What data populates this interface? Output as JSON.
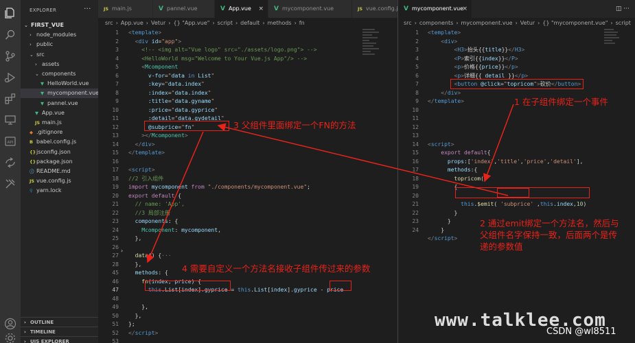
{
  "activity_bar": {
    "icons": [
      "files-icon",
      "search-icon",
      "source-control-icon",
      "run-debug-icon",
      "extensions-icon",
      "remote-explorer-icon",
      "api-icon",
      "live-share-icon",
      "tools-icon",
      "account-icon",
      "settings-gear-icon"
    ]
  },
  "sidebar": {
    "title": "EXPLORER",
    "more": "···",
    "tree": [
      {
        "label": "FIRST_VUE",
        "depth": 0,
        "type": "root",
        "twisty": "⌄"
      },
      {
        "label": "node_modules",
        "depth": 1,
        "type": "folder",
        "twisty": "›"
      },
      {
        "label": "public",
        "depth": 1,
        "type": "folder",
        "twisty": "›"
      },
      {
        "label": "src",
        "depth": 1,
        "type": "folder",
        "twisty": "⌄"
      },
      {
        "label": "assets",
        "depth": 2,
        "type": "folder",
        "twisty": "›"
      },
      {
        "label": "components",
        "depth": 2,
        "type": "folder",
        "twisty": "⌄"
      },
      {
        "label": "HelloWorld.vue",
        "depth": 3,
        "type": "vue"
      },
      {
        "label": "mycomponent.vue",
        "depth": 3,
        "type": "vue",
        "active": true
      },
      {
        "label": "pannel.vue",
        "depth": 3,
        "type": "vue"
      },
      {
        "label": "App.vue",
        "depth": 2,
        "type": "vue"
      },
      {
        "label": "main.js",
        "depth": 2,
        "type": "js"
      },
      {
        "label": ".gitignore",
        "depth": 1,
        "type": "git"
      },
      {
        "label": "babel.config.js",
        "depth": 1,
        "type": "babel"
      },
      {
        "label": "jsconfig.json",
        "depth": 1,
        "type": "json"
      },
      {
        "label": "package.json",
        "depth": 1,
        "type": "json"
      },
      {
        "label": "README.md",
        "depth": 1,
        "type": "md"
      },
      {
        "label": "vue.config.js",
        "depth": 1,
        "type": "js"
      },
      {
        "label": "yarn.lock",
        "depth": 1,
        "type": "yarn"
      }
    ],
    "sections": [
      {
        "label": "OUTLINE",
        "twisty": "›"
      },
      {
        "label": "TIMELINE",
        "twisty": "›"
      },
      {
        "label": "UIS EXPLORER",
        "twisty": "›"
      }
    ]
  },
  "left_group": {
    "tabs": [
      {
        "label": "main.js",
        "icon": "JS",
        "icon_color": "#cbcb41",
        "active": false,
        "close": ""
      },
      {
        "label": "pannel.vue",
        "icon": "V",
        "icon_color": "#41b883",
        "active": false,
        "close": ""
      },
      {
        "label": "App.vue",
        "icon": "V",
        "icon_color": "#41b883",
        "active": true,
        "close": "×"
      },
      {
        "label": "mycomponent.vue",
        "icon": "V",
        "icon_color": "#41b883",
        "active": false,
        "close": ""
      },
      {
        "label": "vue.config.js",
        "icon": "JS",
        "icon_color": "#cbcb41",
        "active": false,
        "close": ""
      }
    ],
    "breadcrumb": [
      "src",
      "›",
      "App.vue",
      "›",
      "Vetur",
      "›",
      "{} \"App.vue\"",
      "›",
      "script",
      "›",
      "default",
      "›",
      "methods",
      "›",
      "fn"
    ],
    "current_line": 47
  },
  "right_group": {
    "tabs": [
      {
        "label": "mycomponent.vue",
        "icon": "V",
        "icon_color": "#41b883",
        "active": true,
        "close": "×"
      }
    ],
    "actions": "◫ ···",
    "breadcrumb": [
      "src",
      "›",
      "components",
      "›",
      "mycomponent.vue",
      "›",
      "Vetur",
      "›",
      "{} \"mycomponent.vue\"",
      "›",
      "script"
    ]
  },
  "annotations": {
    "a1": "1 在子组件绑定一个事件",
    "a2_line1": "2 通过emit绑定一个方法名，然后与",
    "a2_line2": "父组件名字保持一致，后面两个是传",
    "a2_line3": "递的参数值",
    "a3": "3 父组件里面绑定一个FN的方法",
    "a4": "4 需要自定义一个方法名接收子组件传过来的参数"
  },
  "watermark": {
    "site": "www.talklee.com",
    "author": "CSDN @wl8511"
  },
  "colors": {
    "annotation_red": "#e8231a",
    "editor_bg": "#1e1e1e",
    "sidebar_bg": "#252526",
    "activity_bg": "#333333"
  }
}
